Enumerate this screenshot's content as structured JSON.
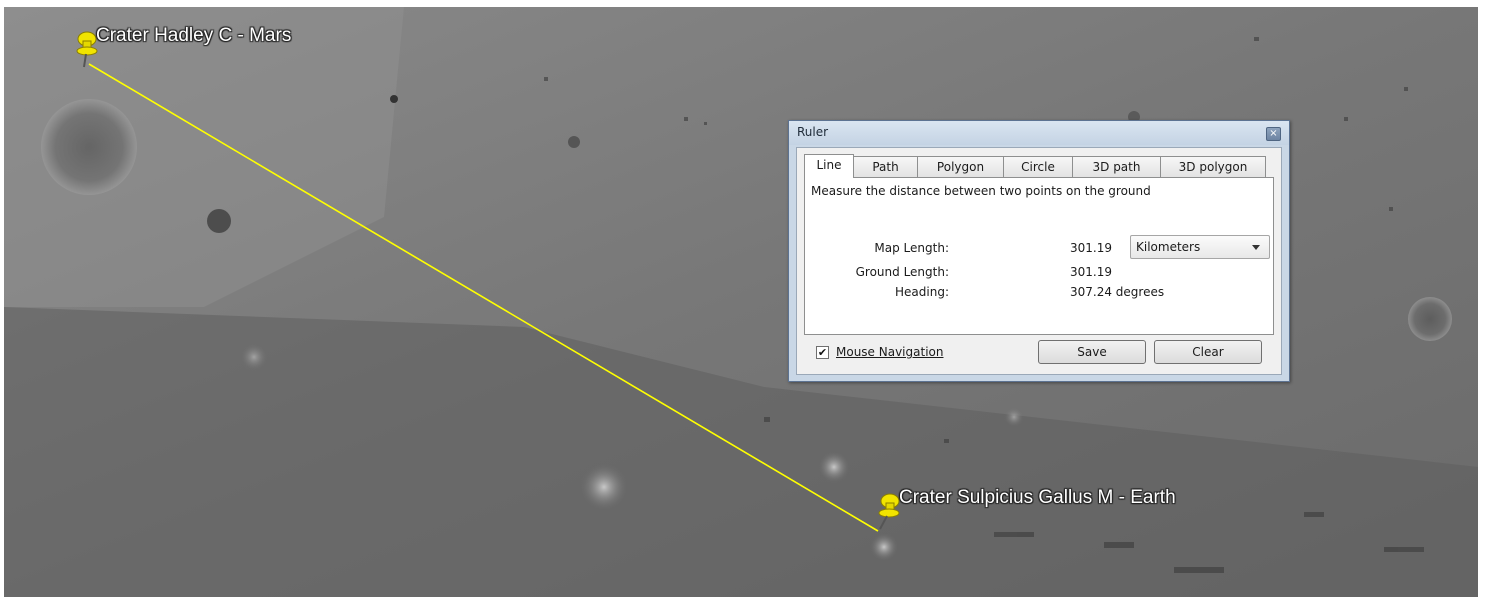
{
  "placemarks": [
    {
      "label": "Crater Hadley C - Mars"
    },
    {
      "label": "Crater Sulpicius Gallus M -  Earth"
    }
  ],
  "ruler": {
    "title": "Ruler",
    "close_glyph": "×",
    "tabs": [
      "Line",
      "Path",
      "Polygon",
      "Circle",
      "3D path",
      "3D polygon"
    ],
    "active_tab": "Line",
    "description": "Measure the distance between two points on the ground",
    "fields": {
      "map_length_label": "Map Length:",
      "map_length_value": "301.19",
      "unit_selected": "Kilometers",
      "ground_length_label": "Ground Length:",
      "ground_length_value": "301.19",
      "heading_label": "Heading:",
      "heading_value": "307.24 degrees"
    },
    "mouse_navigation": {
      "label": "Mouse Navigation",
      "checked": true,
      "check_glyph": "✔"
    },
    "buttons": {
      "save": "Save",
      "clear": "Clear"
    }
  },
  "colors": {
    "measure_line": "#ffff00",
    "pushpin": "#f1e400"
  },
  "icons": {
    "pushpin": "pushpin-icon",
    "close": "close-icon",
    "dropdown": "chevron-down-icon"
  }
}
